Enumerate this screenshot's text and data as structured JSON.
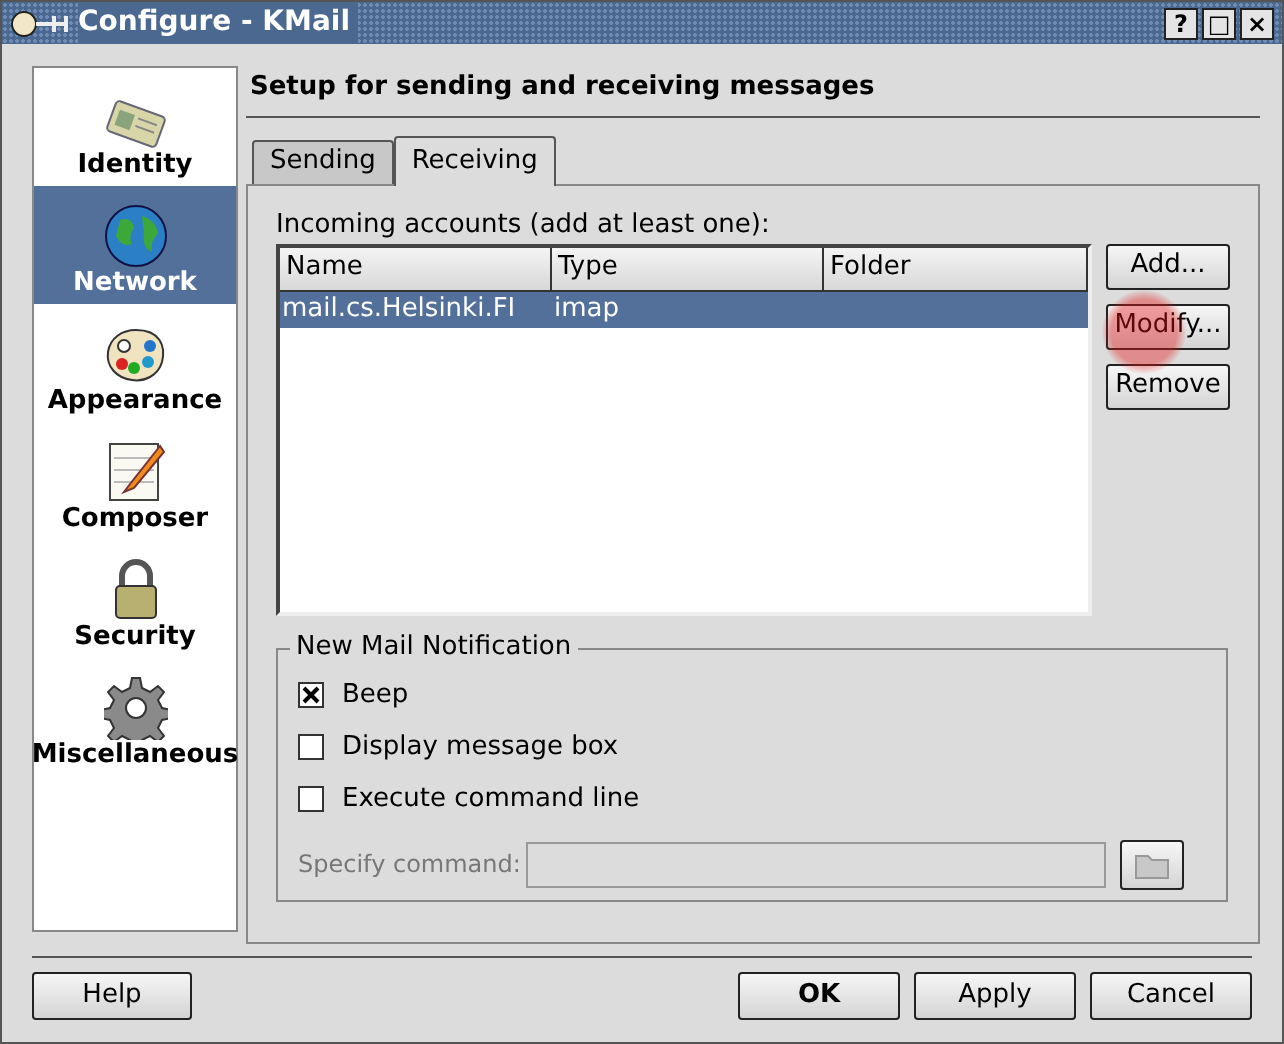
{
  "window": {
    "title": "Configure - KMail",
    "buttons": [
      "?",
      "□",
      "×"
    ]
  },
  "sidebar": {
    "items": [
      {
        "label": "Identity",
        "kind": "identity",
        "selected": false
      },
      {
        "label": "Network",
        "kind": "network",
        "selected": true
      },
      {
        "label": "Appearance",
        "kind": "appearance",
        "selected": false
      },
      {
        "label": "Composer",
        "kind": "composer",
        "selected": false
      },
      {
        "label": "Security",
        "kind": "security",
        "selected": false
      },
      {
        "label": "Miscellaneous",
        "kind": "misc",
        "selected": false
      }
    ]
  },
  "heading": "Setup for sending and receiving messages",
  "tabs": [
    {
      "label": "Sending",
      "selected": false
    },
    {
      "label": "Receiving",
      "selected": true
    }
  ],
  "accounts_label": "Incoming accounts (add at least one):",
  "table": {
    "columns": [
      "Name",
      "Type",
      "Folder"
    ],
    "rows": [
      {
        "cells": [
          "mail.cs.Helsinki.FI",
          "imap",
          ""
        ],
        "selected": true
      }
    ]
  },
  "account_buttons": [
    "Add...",
    "Modify...",
    "Remove"
  ],
  "notification": {
    "title": "New Mail Notification",
    "options": [
      {
        "label": "Beep",
        "checked": true
      },
      {
        "label": "Display message box",
        "checked": false
      },
      {
        "label": "Execute command line",
        "checked": false
      }
    ],
    "command": {
      "label": "Specify command:",
      "disabled": true
    }
  },
  "footer": {
    "help": "Help",
    "buttons": [
      "OK",
      "Apply",
      "Cancel"
    ]
  }
}
